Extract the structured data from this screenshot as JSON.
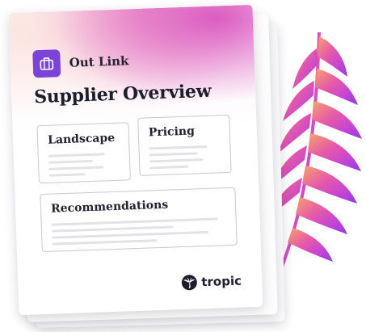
{
  "header": {
    "company_name": "Out Link",
    "logo_icon": "briefcase-icon",
    "accent_color": "#7b43d8"
  },
  "document": {
    "title": "Supplier Overview"
  },
  "sections": {
    "landscape": {
      "title": "Landscape"
    },
    "pricing": {
      "title": "Pricing"
    },
    "recommendations": {
      "title": "Recommendations"
    }
  },
  "footer": {
    "brand_name": "tropic",
    "brand_icon": "palm-logo-icon"
  },
  "decoration": {
    "leaf_icon": "palm-leaf-icon",
    "leaf_colors": [
      "#f7a36b",
      "#e65aa8",
      "#c043d8",
      "#8a3fe0"
    ]
  }
}
